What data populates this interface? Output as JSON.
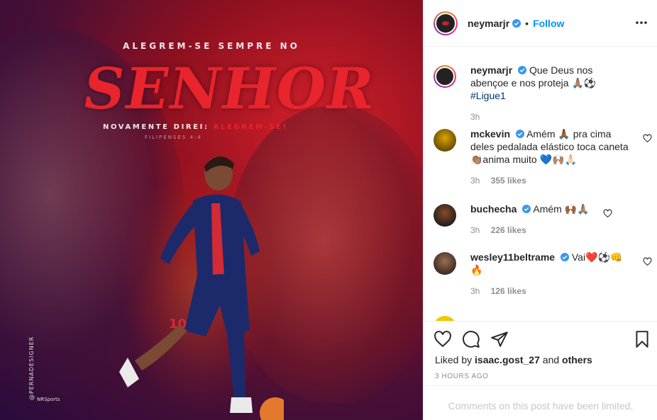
{
  "post_image": {
    "tagline": "ALEGREM-SE SEMPRE NO",
    "title": "SENHOR",
    "subline": "NOVAMENTE DIREI:",
    "subline_accent": "ALEGREM-SE!",
    "verse": "FILIPENSES 4:4",
    "designer": "@PERNADESIGNER",
    "brand": "NRSports",
    "jersey_number": "10"
  },
  "header": {
    "username": "neymarjr",
    "separator": "•",
    "follow_label": "Follow"
  },
  "caption": {
    "username": "neymarjr",
    "text": "Que Deus nos abençoe e nos proteja 🙏🏽⚽️",
    "hashtag": "#Ligue1",
    "time": "3h"
  },
  "comments": [
    {
      "username": "mckevin",
      "text": "Amém 🙏🏾 pra cima deles pedalada elástico toca caneta 👏🏽anima muito 💙🙌🏽🙏🏻",
      "time": "3h",
      "likes": "355 likes"
    },
    {
      "username": "buchecha",
      "text": "Amém 🙌🏾🙏🏽",
      "time": "3h",
      "likes": "226 likes"
    },
    {
      "username": "wesley11beltrame",
      "text": "Vai❤️⚽️👊 🔥",
      "time": "3h",
      "likes": "126 likes"
    },
    {
      "username": "...",
      "text": "",
      "time": "",
      "likes": ""
    }
  ],
  "footer": {
    "liked_by_prefix": "Liked by",
    "liked_by_user": "isaac.gost_27",
    "liked_by_and": "and",
    "liked_by_others": "others",
    "time_ago": "3 HOURS AGO",
    "comments_limited": "Comments on this post have been limited."
  },
  "colors": {
    "accent_blue": "#0095f6",
    "verified_blue": "#3897f0",
    "poster_red": "#e8242c"
  }
}
